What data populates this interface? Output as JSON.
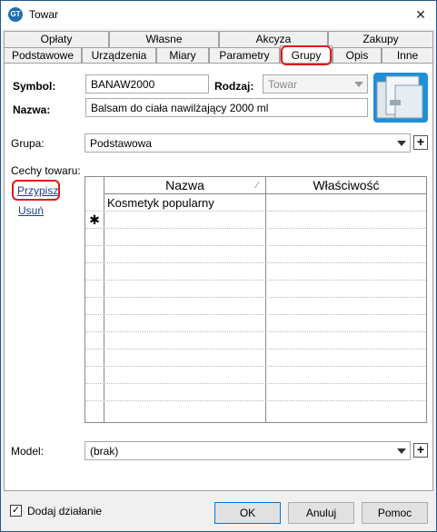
{
  "window": {
    "title": "Towar",
    "close": "✕",
    "icon_text": "GT"
  },
  "tabs_row1": [
    "Opłaty",
    "Własne",
    "Akcyza",
    "Zakupy"
  ],
  "tabs_row2": [
    "Podstawowe",
    "Urządzenia",
    "Miary",
    "Parametry",
    "Grupy",
    "Opis",
    "Inne"
  ],
  "active_tab": "Grupy",
  "form": {
    "symbol_label": "Symbol:",
    "symbol_value": "BANAW2000",
    "rodzaj_label": "Rodzaj:",
    "rodzaj_value": "Towar",
    "nazwa_label": "Nazwa:",
    "nazwa_value": "Balsam do ciała nawilżający 2000 ml",
    "grupa_label": "Grupa:",
    "grupa_value": "Podstawowa",
    "cechy_label": "Cechy towaru:",
    "przypisz": "Przypisz",
    "usun": "Usuń",
    "model_label": "Model:",
    "model_value": "(brak)",
    "plus": "+"
  },
  "grid": {
    "headers": [
      "Nazwa",
      "Właściwość"
    ],
    "sort_indicator": "⁄",
    "rows": [
      {
        "marker": "",
        "nazwa": "Kosmetyk popularny",
        "wlasciwosc": ""
      },
      {
        "marker": "✱",
        "nazwa": "",
        "wlasciwosc": ""
      }
    ]
  },
  "footer": {
    "checkbox_label": "Dodaj działanie",
    "checkbox_checked": true,
    "checkmark": "✓",
    "ok": "OK",
    "anuluj": "Anuluj",
    "pomoc": "Pomoc"
  },
  "colors": {
    "highlight": "#e0191b",
    "title_icon": "#1f6fb2",
    "link": "#1a3f8f"
  }
}
